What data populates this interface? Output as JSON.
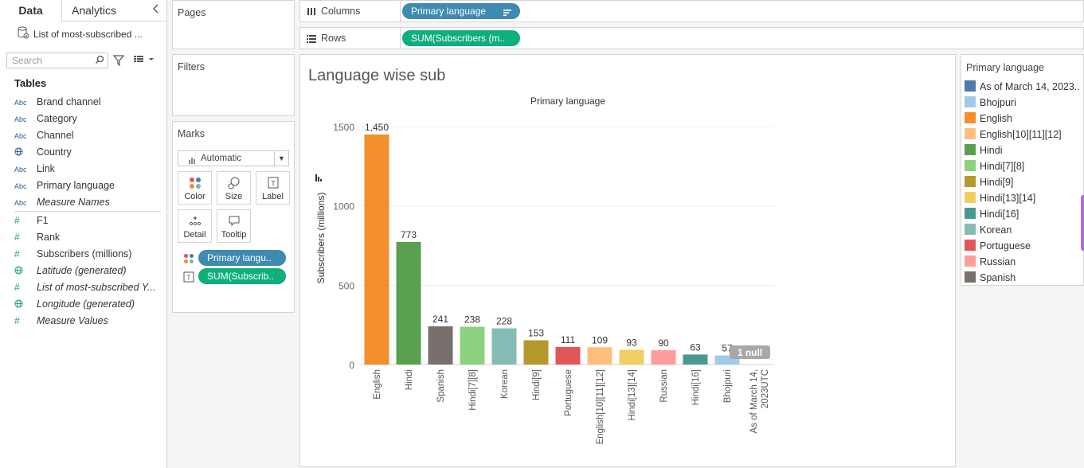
{
  "tabs": {
    "data": "Data",
    "analytics": "Analytics"
  },
  "datasource": "List of most-subscribed ...",
  "search": {
    "placeholder": "Search"
  },
  "tables_heading": "Tables",
  "fields": [
    {
      "type": "Abc",
      "name": "Brand channel",
      "italic": false,
      "kind": "dim"
    },
    {
      "type": "Abc",
      "name": "Category",
      "italic": false,
      "kind": "dim"
    },
    {
      "type": "Abc",
      "name": "Channel",
      "italic": false,
      "kind": "dim"
    },
    {
      "type": "globe",
      "name": "Country",
      "italic": false,
      "kind": "dim"
    },
    {
      "type": "Abc",
      "name": "Link",
      "italic": false,
      "kind": "dim"
    },
    {
      "type": "Abc",
      "name": "Primary language",
      "italic": false,
      "kind": "dim"
    },
    {
      "type": "Abc",
      "name": "Measure Names",
      "italic": true,
      "kind": "dim"
    },
    {
      "type": "#",
      "name": "F1",
      "italic": false,
      "kind": "measure"
    },
    {
      "type": "#",
      "name": "Rank",
      "italic": false,
      "kind": "measure"
    },
    {
      "type": "#",
      "name": "Subscribers (millions)",
      "italic": false,
      "kind": "measure"
    },
    {
      "type": "globe",
      "name": "Latitude (generated)",
      "italic": true,
      "kind": "measure"
    },
    {
      "type": "#",
      "name": "List of most-subscribed Y...",
      "italic": true,
      "kind": "measure"
    },
    {
      "type": "globe",
      "name": "Longitude (generated)",
      "italic": true,
      "kind": "measure"
    },
    {
      "type": "#",
      "name": "Measure Values",
      "italic": true,
      "kind": "measure"
    }
  ],
  "cards": {
    "pages": "Pages",
    "filters": "Filters",
    "marks": "Marks"
  },
  "marks": {
    "type": "Automatic",
    "buttons": [
      "Color",
      "Size",
      "Label",
      "Detail",
      "Tooltip"
    ],
    "pills": [
      "Primary langu..",
      "SUM(Subscrib.."
    ]
  },
  "shelves": {
    "columns_label": "Columns",
    "columns_pill": "Primary language",
    "rows_label": "Rows",
    "rows_pill": "SUM(Subscribers (m.."
  },
  "chart_data": {
    "type": "bar",
    "title": "Language wise sub",
    "header": "Primary language",
    "ylabel": "Subscribers (millions)",
    "ylim": [
      0,
      1600
    ],
    "yticks": [
      0,
      500,
      1000,
      1500
    ],
    "ytick_labels": [
      "0",
      "500",
      "1000",
      "1500"
    ],
    "categories": [
      "English",
      "Hindi",
      "Spanish",
      "Hindi[7][8]",
      "Korean",
      "Hindi[9]",
      "Portuguese",
      "English[10][11][12]",
      "Hindi[13][14]",
      "Russian",
      "Hindi[16]",
      "Bhojpuri",
      "As of March 14, 2023UTC"
    ],
    "category_lines": [
      [
        "English"
      ],
      [
        "Hindi"
      ],
      [
        "Spanish"
      ],
      [
        "Hindi[7][8]"
      ],
      [
        "Korean"
      ],
      [
        "Hindi[9]"
      ],
      [
        "Portuguese"
      ],
      [
        "English[10][11][12]"
      ],
      [
        "Hindi[13][14]"
      ],
      [
        "Russian"
      ],
      [
        "Hindi[16]"
      ],
      [
        "Bhojpuri"
      ],
      [
        "As of March 14,",
        "2023UTC"
      ]
    ],
    "values": [
      1450,
      773,
      241,
      238,
      228,
      153,
      111,
      109,
      93,
      90,
      63,
      57,
      null
    ],
    "value_labels": [
      "1,450",
      "773",
      "241",
      "238",
      "228",
      "153",
      "111",
      "109",
      "93",
      "90",
      "63",
      "57",
      ""
    ],
    "colors": [
      "#f28e2b",
      "#59a14f",
      "#79706e",
      "#8cd17d",
      "#86bcb6",
      "#b6992d",
      "#e15759",
      "#ffbe7d",
      "#f1ce63",
      "#ff9d9a",
      "#499894",
      "#a0cbe8",
      "#4e79a7"
    ],
    "null_badge": "1 null",
    "grid": true
  },
  "legend": {
    "title": "Primary language",
    "items": [
      {
        "label": "As of March 14, 2023..",
        "color": "#4e79a7"
      },
      {
        "label": "Bhojpuri",
        "color": "#a0cbe8"
      },
      {
        "label": "English",
        "color": "#f28e2b"
      },
      {
        "label": "English[10][11][12]",
        "color": "#ffbe7d"
      },
      {
        "label": "Hindi",
        "color": "#59a14f"
      },
      {
        "label": "Hindi[7][8]",
        "color": "#8cd17d"
      },
      {
        "label": "Hindi[9]",
        "color": "#b6992d"
      },
      {
        "label": "Hindi[13][14]",
        "color": "#f1ce63"
      },
      {
        "label": "Hindi[16]",
        "color": "#499894"
      },
      {
        "label": "Korean",
        "color": "#86bcb6"
      },
      {
        "label": "Portuguese",
        "color": "#e15759"
      },
      {
        "label": "Russian",
        "color": "#ff9d9a"
      },
      {
        "label": "Spanish",
        "color": "#79706e"
      }
    ]
  }
}
